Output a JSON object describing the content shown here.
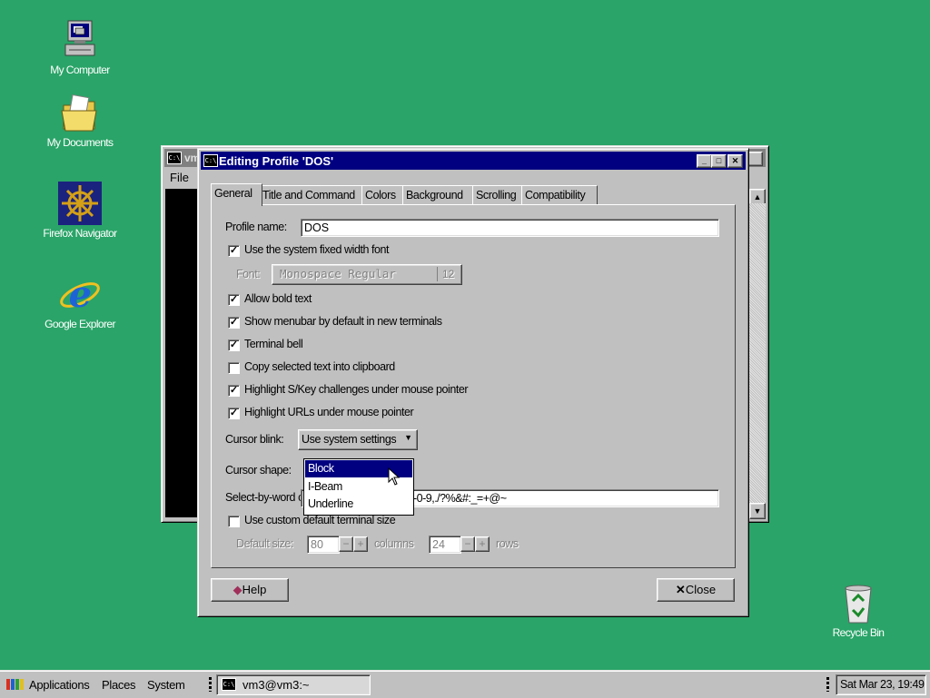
{
  "desktop": {
    "icons": [
      {
        "label": "My Computer",
        "icon": "computer-icon"
      },
      {
        "label": "My Documents",
        "icon": "folder-icon"
      },
      {
        "label": "Firefox Navigator",
        "icon": "ship-wheel-icon"
      },
      {
        "label": "Google Explorer",
        "icon": "ie-icon"
      },
      {
        "label": "Recycle Bin",
        "icon": "recycle-bin-icon"
      }
    ]
  },
  "terminal": {
    "title": "vm",
    "menu_file": "File"
  },
  "dialog": {
    "title": "Editing Profile 'DOS'",
    "tabs": [
      "General",
      "Title and Command",
      "Colors",
      "Background",
      "Scrolling",
      "Compatibility"
    ],
    "active_tab": "General",
    "profile_name_label": "Profile name:",
    "profile_name_value": "DOS",
    "options": [
      {
        "label": "Use the system fixed width font",
        "checked": true
      },
      {
        "label": "Allow bold text",
        "checked": true
      },
      {
        "label": "Show menubar by default in new terminals",
        "checked": true
      },
      {
        "label": "Terminal bell",
        "checked": true
      },
      {
        "label": "Copy selected text into clipboard",
        "checked": false
      },
      {
        "label": "Highlight S/Key challenges under mouse pointer",
        "checked": true
      },
      {
        "label": "Highlight URLs under mouse pointer",
        "checked": true
      },
      {
        "label": "Use custom default terminal size",
        "checked": false
      }
    ],
    "font_label": "Font:",
    "font_name": "Monospace Regular",
    "font_size": "12",
    "cursor_blink_label": "Cursor blink:",
    "cursor_blink_value": "Use system settings",
    "cursor_shape_label": "Cursor shape:",
    "cursor_shape_options": [
      "Block",
      "I-Beam",
      "Underline"
    ],
    "cursor_shape_selected": "Block",
    "select_by_word_label": "Select-by-word c",
    "select_by_word_value": "-0-9,./?%&#:_=+@~",
    "default_size_label": "Default size:",
    "columns_value": "80",
    "columns_label": "columns",
    "rows_value": "24",
    "rows_label": "rows",
    "help_label": "Help",
    "close_label": "Close"
  },
  "taskbar": {
    "applications": "Applications",
    "places": "Places",
    "system": "System",
    "task": "vm3@vm3:~",
    "clock": "Sat Mar 23, 19:49"
  }
}
